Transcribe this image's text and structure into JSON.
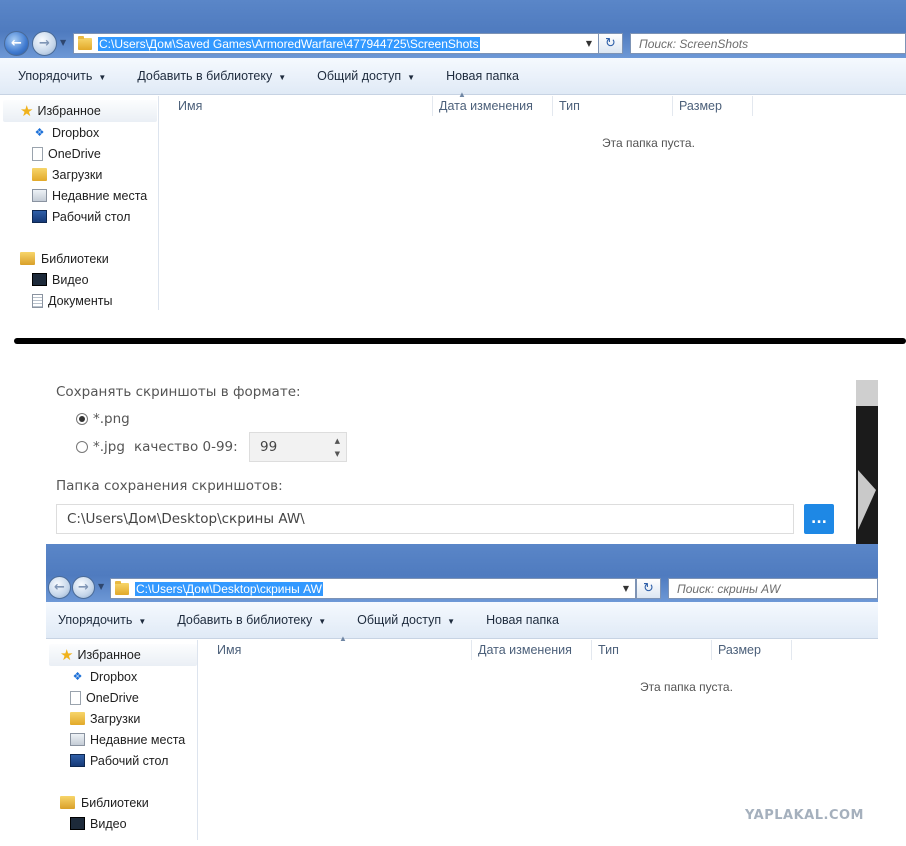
{
  "explorer_top": {
    "address": "C:\\Users\\Дом\\Saved Games\\ArmoredWarfare\\477944725\\ScreenShots",
    "search_placeholder": "Поиск: ScreenShots",
    "toolbar": [
      "Упорядочить",
      "Добавить в библиотеку",
      "Общий доступ",
      "Новая папка"
    ],
    "nav": {
      "favorites": "Избранное",
      "items": [
        "Dropbox",
        "OneDrive",
        "Загрузки",
        "Недавние места",
        "Рабочий стол"
      ],
      "libraries": "Библиотеки",
      "lib_items": [
        "Видео",
        "Документы"
      ]
    },
    "columns": [
      "Имя",
      "Дата изменения",
      "Тип",
      "Размер"
    ],
    "empty_text": "Эта папка пуста."
  },
  "settings": {
    "format_label": "Сохранять скриншоты в формате:",
    "png_label": "*.png",
    "jpg_label": "*.jpg",
    "quality_label": "качество 0-99:",
    "quality_value": "99",
    "selected_format": "png",
    "folder_label": "Папка сохранения скриншотов:",
    "folder_path": "C:\\Users\\Дом\\Desktop\\скрины AW\\",
    "browse_label": "...",
    "accent_color": "#1e88e5"
  },
  "explorer_bottom": {
    "address": "C:\\Users\\Дом\\Desktop\\скрины AW",
    "search_placeholder": "Поиск: скрины AW",
    "toolbar": [
      "Упорядочить",
      "Добавить в библиотеку",
      "Общий доступ",
      "Новая папка"
    ],
    "nav": {
      "favorites": "Избранное",
      "items": [
        "Dropbox",
        "OneDrive",
        "Загрузки",
        "Недавние места",
        "Рабочий стол"
      ],
      "libraries": "Библиотеки",
      "lib_items": [
        "Видео"
      ]
    },
    "columns": [
      "Имя",
      "Дата изменения",
      "Тип",
      "Размер"
    ],
    "empty_text": "Эта папка пуста."
  },
  "watermark": "YAPLAKAL.COM"
}
